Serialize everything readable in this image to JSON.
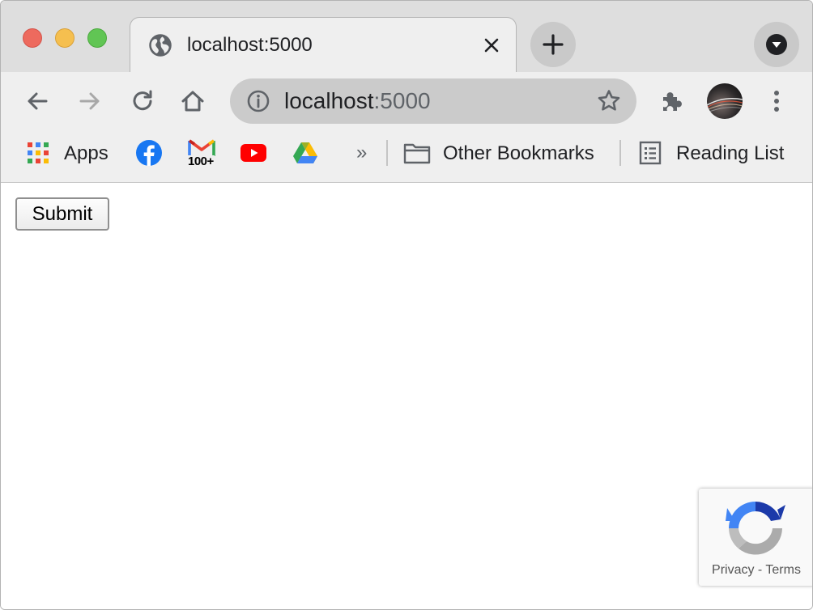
{
  "tab": {
    "title": "localhost:5000"
  },
  "omnibox": {
    "host": "localhost",
    "port": ":5000"
  },
  "bookmarks": {
    "apps_label": "Apps",
    "gmail_badge": "100+",
    "more": "»",
    "other_label": "Other Bookmarks",
    "reading_label": "Reading List"
  },
  "page": {
    "submit_label": "Submit"
  },
  "recaptcha": {
    "privacy": "Privacy",
    "separator": " - ",
    "terms": "Terms"
  },
  "colors": {
    "close": "#ed6a5e",
    "minimize": "#f5bf4f",
    "maximize": "#61c554",
    "toolbar": "#efefef",
    "tabstrip": "#dedede",
    "omnibox": "#cbcbcb",
    "facebook": "#1877f2",
    "youtube": "#ff0000",
    "gmail_red": "#ea4335"
  }
}
